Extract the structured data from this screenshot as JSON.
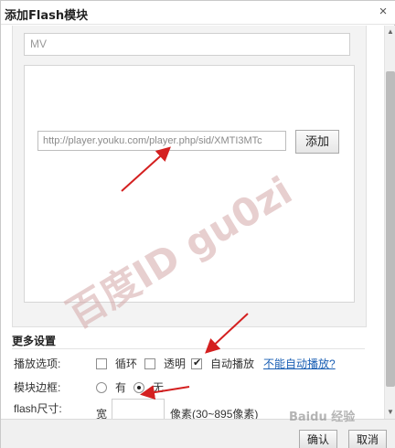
{
  "dialog": {
    "title": "添加Flash模块",
    "close_glyph": "×"
  },
  "form": {
    "name_value": "MV",
    "url_value": "http://player.youku.com/player.php/sid/XMTI3MTc",
    "add_label": "添加"
  },
  "settings": {
    "section_title": "更多设置",
    "play_options_label": "播放选项:",
    "loop_label": "循环",
    "loop_checked": false,
    "transparent_label": "透明",
    "transparent_checked": false,
    "autoplay_label": "自动播放",
    "autoplay_checked": true,
    "autoplay_help_link": "不能自动播放?",
    "border_label": "模块边框:",
    "border_yes_label": "有",
    "border_yes_selected": false,
    "border_no_label": "无",
    "border_no_selected": true,
    "size_label": "flash尺寸:",
    "width_label": "宽",
    "width_value": "",
    "width_unit": "像素(30~895像素)"
  },
  "footer": {
    "confirm_label": "确认",
    "cancel_label": "取消"
  },
  "watermark": {
    "text": "百度ID gu0zi",
    "logo_text": "Baidu 经验"
  },
  "colors": {
    "arrow": "#d42020",
    "link": "#1a5fb4",
    "panel_bg": "#f3f3f3"
  }
}
